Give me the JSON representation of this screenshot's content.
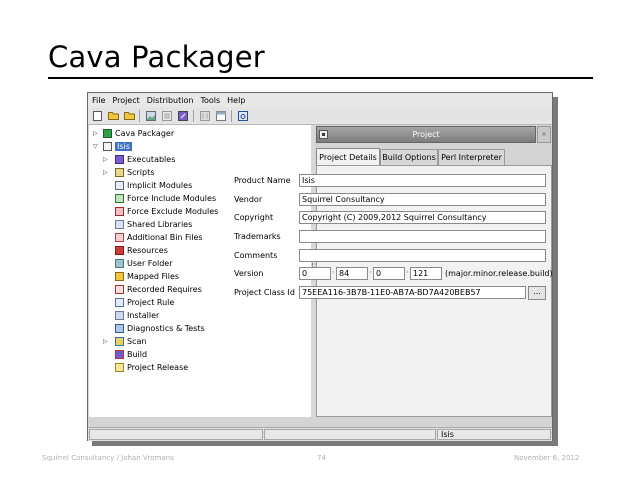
{
  "slide": {
    "title": "Cava Packager",
    "footer_left": "Squirrel Consultancy / Johan Vromans",
    "footer_center": "74",
    "footer_right": "November 6, 2012"
  },
  "menu": [
    "File",
    "Project",
    "Distribution",
    "Tools",
    "Help"
  ],
  "tree": {
    "root": "Cava Packager",
    "project": "Isis",
    "items": [
      "Executables",
      "Scripts",
      "Implicit Modules",
      "Force Include Modules",
      "Force Exclude Modules",
      "Shared Libraries",
      "Additional Bin Files",
      "Resources",
      "User Folder",
      "Mapped Files",
      "Recorded Requires",
      "Project Rule",
      "Installer",
      "Diagnostics & Tests",
      "Scan",
      "Build",
      "Project Release"
    ]
  },
  "panel": {
    "header": "Project",
    "tabs": [
      "Project Details",
      "Build Options",
      "Perl Interpreter"
    ],
    "fields": {
      "product_name": {
        "label": "Product Name",
        "value": "Isis"
      },
      "vendor": {
        "label": "Vendor",
        "value": "Squirrel Consultancy"
      },
      "copyright": {
        "label": "Copyright",
        "value": "Copyright (C) 2009,2012 Squirrel Consultancy"
      },
      "trademarks": {
        "label": "Trademarks",
        "value": ""
      },
      "comments": {
        "label": "Comments",
        "value": ""
      },
      "version": {
        "label": "Version",
        "major": "0",
        "minor": "84",
        "release": "0",
        "build": "121",
        "hint": "(major.minor.release.build)"
      },
      "class_id": {
        "label": "Project Class Id",
        "value": "75EEA116-3B7B-11E0-AB7A-BD7A420BEB57",
        "button": "..."
      }
    }
  },
  "status": {
    "project": "Isis"
  }
}
